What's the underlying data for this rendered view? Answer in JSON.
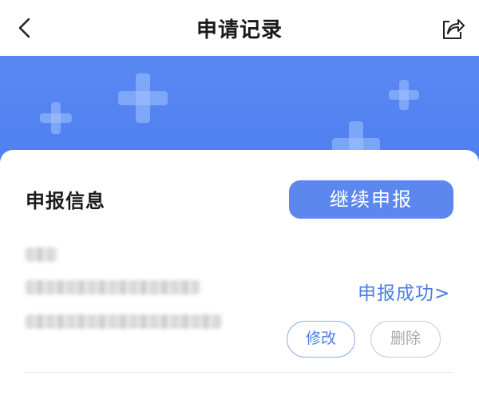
{
  "nav": {
    "title": "申请记录",
    "back_icon": "chevron-left-icon",
    "share_icon": "share-icon"
  },
  "banner": {
    "background_color": "#5586f1",
    "decoration": "plus-shapes"
  },
  "record": {
    "section_title": "申报信息",
    "continue_button": "继续申报",
    "status": "申报成功>",
    "edit_button": "修改",
    "delete_button": "删除"
  },
  "colors": {
    "accent": "#5b87ee",
    "link": "#4a7ee6",
    "disabled": "#a8a8a8"
  }
}
